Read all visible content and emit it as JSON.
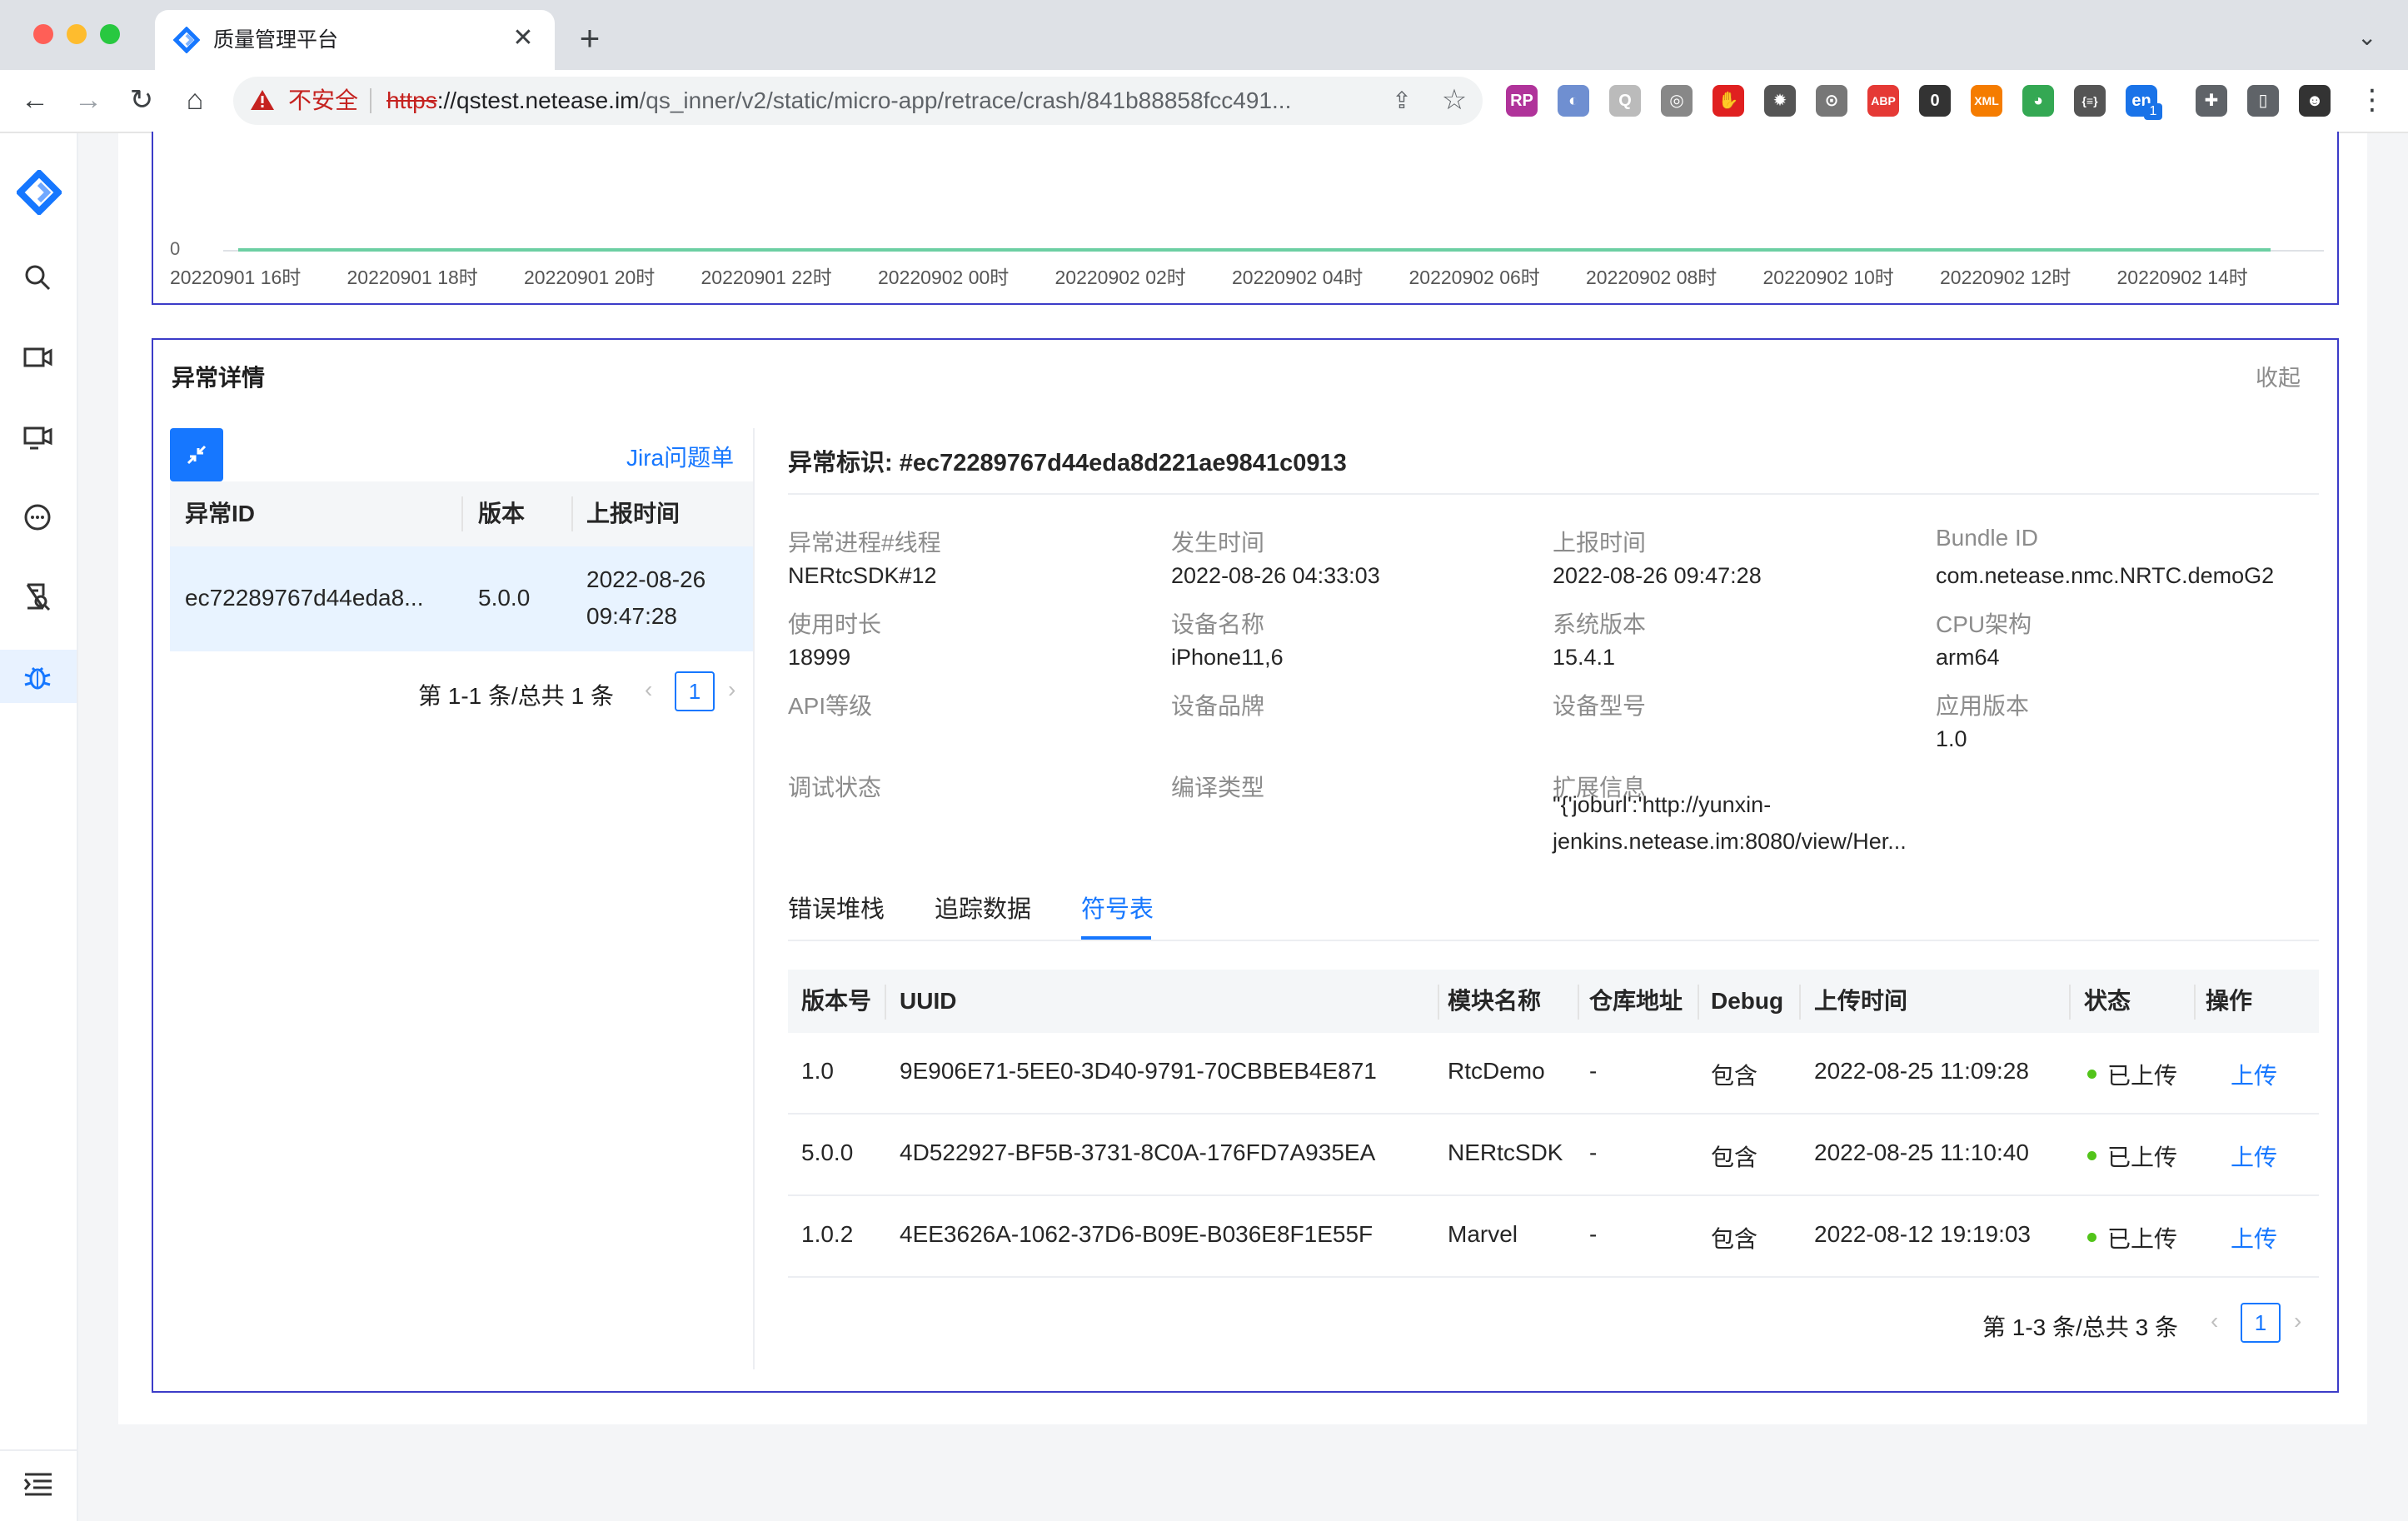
{
  "browser": {
    "tab_title": "质量管理平台",
    "tab_close_glyph": "✕",
    "new_tab_glyph": "+",
    "tab_menu_glyph": "⌄",
    "insecure_label": "不安全",
    "url_scheme": "https",
    "url_host": "://qstest.netease.im",
    "url_path": "/qs_inner/v2/static/micro-app/retrace/crash/841b88858fcc491...",
    "nav": {
      "back": "←",
      "forward": "→",
      "reload": "↻",
      "home": "⌂"
    },
    "share_glyph": "⇪",
    "star_glyph": "☆",
    "menu_glyph": "⋮",
    "extensions": [
      {
        "name": "rp-extension-icon",
        "glyph": "RP",
        "color": "#b0339a"
      },
      {
        "name": "feather-extension-icon",
        "glyph": "◐",
        "color": "#6f8fd1"
      },
      {
        "name": "q-extension-icon",
        "glyph": "Q",
        "color": "#bbbbbb"
      },
      {
        "name": "circle-extension-icon",
        "glyph": "◎",
        "color": "#888888"
      },
      {
        "name": "stop-extension-icon",
        "glyph": "✋",
        "color": "#e02020"
      },
      {
        "name": "gear-extension-icon",
        "glyph": "✹",
        "color": "#555555"
      },
      {
        "name": "dots-extension-icon",
        "glyph": "⊙",
        "color": "#777777"
      },
      {
        "name": "abp-extension-icon",
        "glyph": "ABP",
        "color": "#e53935"
      },
      {
        "name": "zero-extension-icon",
        "glyph": "0",
        "color": "#333333"
      },
      {
        "name": "xml-extension-icon",
        "glyph": "XML",
        "color": "#f57c00"
      },
      {
        "name": "chrome-extension-icon",
        "glyph": "◕",
        "color": "#34a853"
      },
      {
        "name": "json-extension-icon",
        "glyph": "{≡}",
        "color": "#555555"
      },
      {
        "name": "translate-extension-icon",
        "glyph": "en",
        "color": "#1a73e8"
      },
      {
        "name": "puzzle-extension-icon",
        "glyph": "✚",
        "color": "#5f6368"
      },
      {
        "name": "sidepanel-extension-icon",
        "glyph": "▯",
        "color": "#5f6368"
      },
      {
        "name": "profile-avatar-icon",
        "glyph": "☻",
        "color": "#333333"
      }
    ],
    "translate_badge": "1"
  },
  "chart": {
    "y_zero": "0",
    "x_ticks": [
      "20220901 16时",
      "20220901 18时",
      "20220901 20时",
      "20220901 22时",
      "20220902 00时",
      "20220902 02时",
      "20220902 04时",
      "20220902 06时",
      "20220902 08时",
      "20220902 10时",
      "20220902 12时",
      "20220902 14时"
    ]
  },
  "detail": {
    "title": "异常详情",
    "collapse_label": "收起",
    "jira_label": "Jira问题单",
    "list_headers": [
      "异常ID",
      "版本",
      "上报时间"
    ],
    "list_rows": [
      {
        "id": "ec72289767d44eda8...",
        "version": "5.0.0",
        "time_date": "2022-08-26",
        "time_clock": "09:47:28"
      }
    ],
    "list_pager": {
      "text": "第 1-1 条/总共 1 条",
      "page": "1",
      "prev": "‹",
      "next": "›"
    },
    "ident_label": "异常标识: #ec72289767d44eda8d221ae9841c0913",
    "fields": [
      {
        "label": "异常进程#线程",
        "value": "NERtcSDK#12"
      },
      {
        "label": "发生时间",
        "value": "2022-08-26 04:33:03"
      },
      {
        "label": "上报时间",
        "value": "2022-08-26 09:47:28"
      },
      {
        "label": "Bundle ID",
        "value": "com.netease.nmc.NRTC.demoG2"
      },
      {
        "label": "使用时长",
        "value": "18999"
      },
      {
        "label": "设备名称",
        "value": "iPhone11,6"
      },
      {
        "label": "系统版本",
        "value": "15.4.1"
      },
      {
        "label": "CPU架构",
        "value": "arm64"
      },
      {
        "label": "API等级",
        "value": ""
      },
      {
        "label": "设备品牌",
        "value": ""
      },
      {
        "label": "设备型号",
        "value": ""
      },
      {
        "label": "应用版本",
        "value": "1.0"
      },
      {
        "label": "调试状态",
        "value": ""
      },
      {
        "label": "编译类型",
        "value": ""
      },
      {
        "label": "扩展信息",
        "value": "\"{'joburl':'http://yunxin-jenkins.netease.im:8080/view/Her..."
      }
    ],
    "tabs": [
      "错误堆栈",
      "追踪数据",
      "符号表"
    ],
    "active_tab": 2,
    "symbol_headers": [
      "版本号",
      "UUID",
      "模块名称",
      "仓库地址",
      "Debug",
      "上传时间",
      "状态",
      "操作"
    ],
    "symbol_rows": [
      {
        "version": "1.0",
        "uuid": "9E906E71-5EE0-3D40-9791-70CBBEB4E871",
        "module": "RtcDemo",
        "repo": "-",
        "debug": "包含",
        "time": "2022-08-25 11:09:28",
        "status": "已上传",
        "action": "上传"
      },
      {
        "version": "5.0.0",
        "uuid": "4D522927-BF5B-3731-8C0A-176FD7A935EA",
        "module": "NERtcSDK",
        "repo": "-",
        "debug": "包含",
        "time": "2022-08-25 11:10:40",
        "status": "已上传",
        "action": "上传"
      },
      {
        "version": "1.0.2",
        "uuid": "4EE3626A-1062-37D6-B09E-B036E8F1E55F",
        "module": "Marvel",
        "repo": "-",
        "debug": "包含",
        "time": "2022-08-12 19:19:03",
        "status": "已上传",
        "action": "上传"
      }
    ],
    "symbol_pager": {
      "text": "第 1-3 条/总共 3 条",
      "page": "1",
      "prev": "‹",
      "next": "›"
    }
  },
  "colors": {
    "accent": "#1677ff",
    "status_ok": "#52c41a",
    "border": "#3c3cc8",
    "chart_series": "#6ccfa3"
  }
}
